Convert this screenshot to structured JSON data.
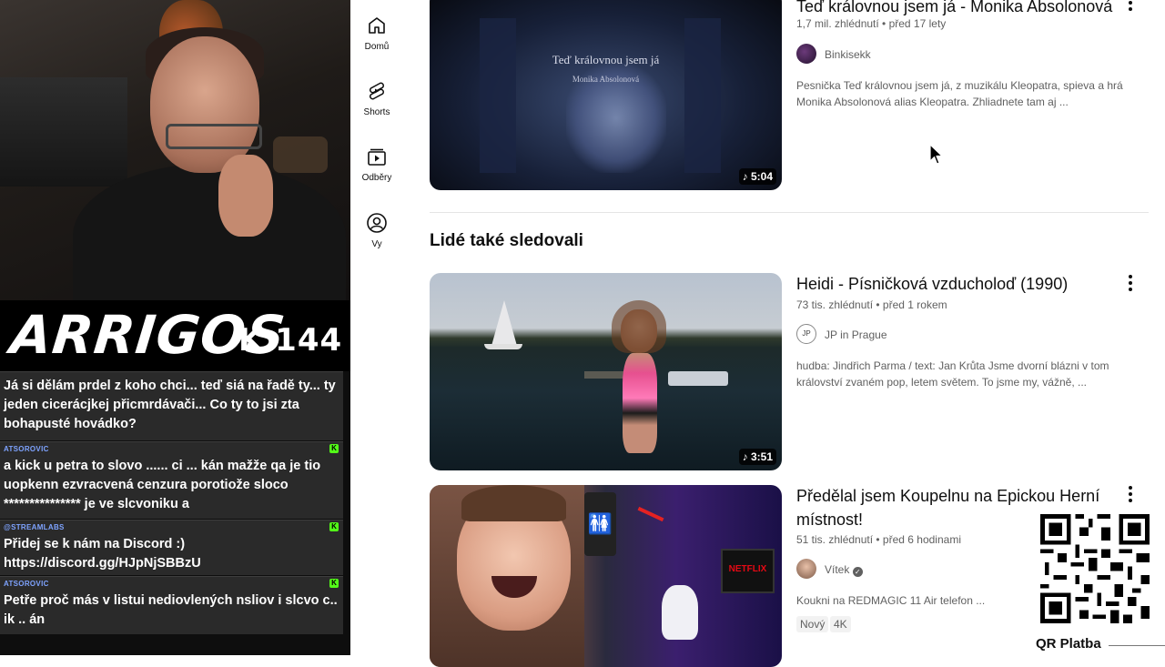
{
  "overlay": {
    "logo": "ARRIGOS",
    "logo_sub": "K 144",
    "chat": [
      {
        "user": "",
        "text": "Já si dělám prdel z koho chci... teď siá na řadě ty... ty jeden cicerácjkej přicmrdávači... Co ty to jsi zta bohapusté hovádko?",
        "kick_icon": false
      },
      {
        "user": "ATSOROVIC",
        "text": "a kick u petra to slovo ...... ci ... kán mažže qa je tio uopkenn ezvracvená cenzura porotiože sloco *************** je ve slcvoniku a",
        "kick_icon": true
      },
      {
        "user": "@STREAMLABS",
        "text": "Přidej se k nám na Discord :)\nhttps://discord.gg/HJpNjSBBzU",
        "kick_icon": true
      },
      {
        "user": "ATSOROVIC",
        "text": "Petře proč más v listui nediovlených nsliov i slcvo c.. ik .. án",
        "kick_icon": true
      }
    ]
  },
  "nav": [
    {
      "label": "Domů",
      "icon": "home-icon"
    },
    {
      "label": "Shorts",
      "icon": "shorts-icon"
    },
    {
      "label": "Odběry",
      "icon": "subscriptions-icon"
    },
    {
      "label": "Vy",
      "icon": "account-icon"
    }
  ],
  "videos": [
    {
      "title": "Teď královnou jsem já - Monika Absolonová",
      "meta": "1,7 mil. zhlédnutí • před 17 lety",
      "channel": "Binkisekk",
      "description": "Pesnička Teď královnou jsem já, z muzikálu Kleopatra, spieva a hrá Monika Absolonová alias Kleopatra. Zhliadnete tam aj ...",
      "duration": "5:04",
      "thumb_caption": "Teď královnou jsem já",
      "thumb_caption2": "Monika Absolonová"
    },
    {
      "title": "Heidi - Písničková vzducholoď (1990)",
      "meta": "73 tis. zhlédnutí • před 1 rokem",
      "channel": "JP in Prague",
      "description": "hudba: Jindřich Parma / text: Jan Krůta Jsme dvorní blázni v tom království zvaném pop, letem světem. To jsme my, vážně, ...",
      "duration": "3:51"
    },
    {
      "title": "Předělal jsem Koupelnu na Epickou Herní místnost!",
      "meta": "51 tis. zhlédnutí • před 6 hodinami",
      "channel": "Vítek",
      "description": "Koukni na REDMAGIC 11 Air telefon ...",
      "chips": [
        "Nový",
        "4K"
      ],
      "thumb_badge": "NETFLIX"
    }
  ],
  "section_heading": "Lidé také sledovali",
  "qr_label": "QR Platba"
}
